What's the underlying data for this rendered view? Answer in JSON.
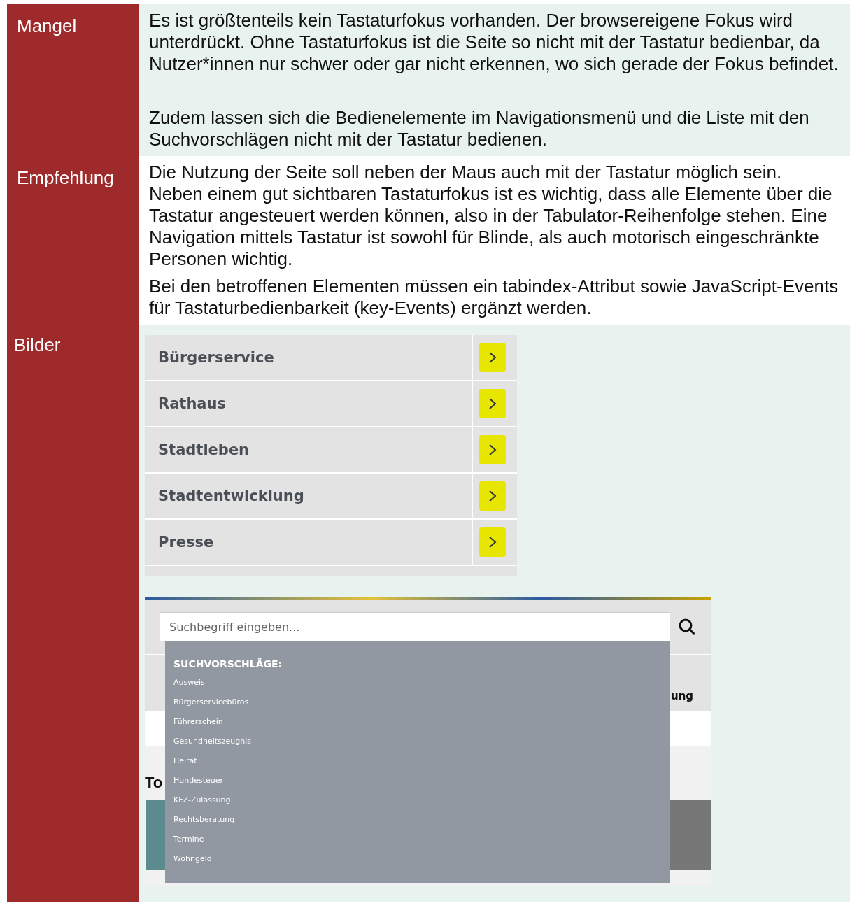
{
  "rows": [
    {
      "label": "Mangel",
      "kind": "text",
      "paragraphs": [
        "Es ist größtenteils kein Tastaturfokus vorhanden. Der browsereigene Fokus wird unterdrückt. Ohne Tastaturfokus ist die Seite so nicht mit der Tastatur bedienbar, da Nutzer*innen nur schwer oder gar nicht erkennen, wo sich gerade der Fokus befindet.",
        "Zudem lassen sich die Bedienelemente im Navigationsmenü und die Liste mit den Suchvorschlägen nicht mit der Tastatur bedienen."
      ],
      "spaced": true
    },
    {
      "label": "Empfehlung",
      "kind": "text",
      "paragraphs": [
        "Die Nutzung der Seite soll neben der Maus auch mit der Tastatur möglich sein. Neben einem gut sichtbaren Tastaturfokus ist es wichtig, dass alle Elemente über die Tastatur angesteuert werden können, also in der Tabulator-Reihenfolge stehen. Eine Navigation mittels Tastatur ist sowohl für Blinde, als auch motorisch eingeschränkte Personen wichtig.",
        "Bei den betroffenen Elementen müssen ein tabindex-Attribut sowie JavaScript-Events für Tastaturbedienbarkeit (key-Events) ergänzt werden."
      ],
      "spaced": false
    },
    {
      "label": "Bilder",
      "kind": "images",
      "nav_menu": [
        {
          "label": "Bürgerservice",
          "highlighted": true
        },
        {
          "label": "Rathaus",
          "highlighted": true
        },
        {
          "label": "Stadtleben",
          "highlighted": true
        },
        {
          "label": "Stadtentwicklung",
          "highlighted": true
        },
        {
          "label": "Presse",
          "highlighted": true
        }
      ],
      "search_screenshot": {
        "placeholder": "Suchbegriff eingeben...",
        "nav_item_fragment": "ung",
        "heading_fragment": "To",
        "suggestions_title": "SUCHVORSCHLÄGE:",
        "suggestions": [
          "Ausweis",
          "Bürgerservicebüros",
          "Führerschein",
          "Gesundheitszeugnis",
          "Heirat",
          "Hundesteuer",
          "KFZ-Zulassung",
          "Rechtsberatung",
          "Termine",
          "Wohngeld"
        ]
      }
    }
  ]
}
